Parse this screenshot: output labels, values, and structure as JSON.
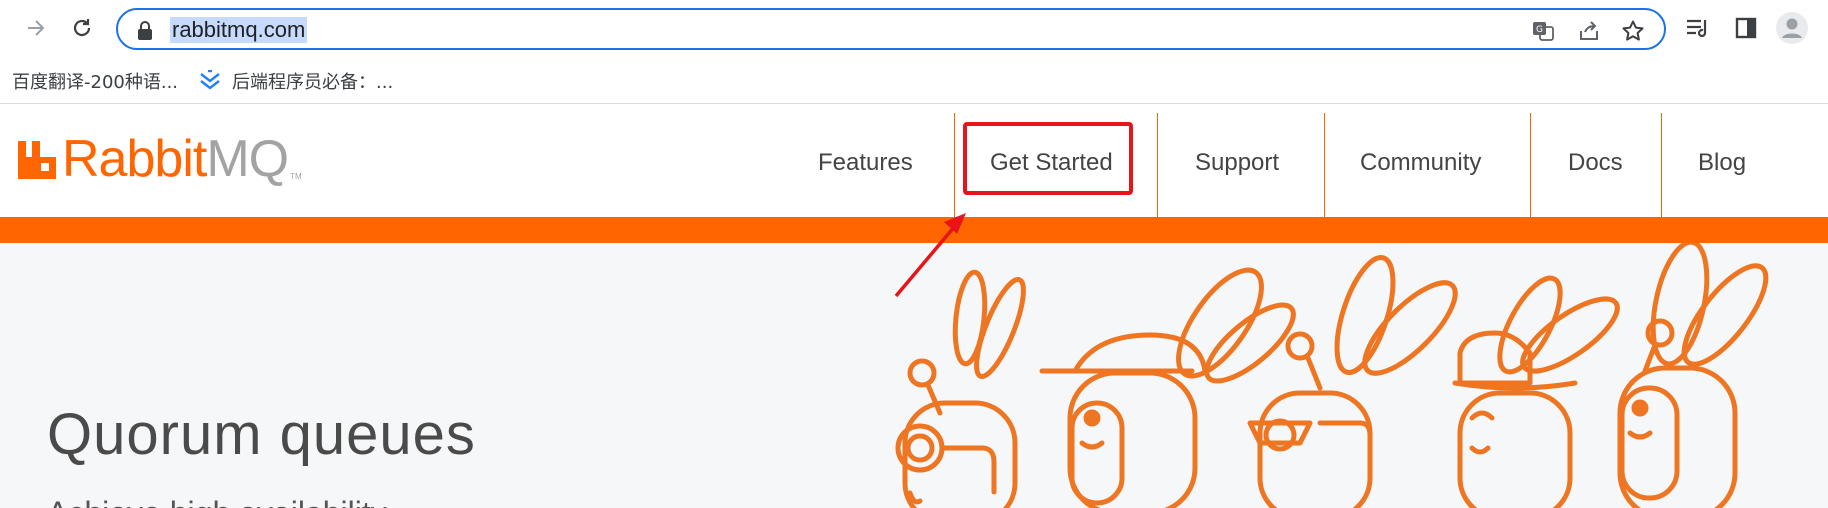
{
  "browser": {
    "url": "rabbitmq.com",
    "bookmarks": [
      {
        "label": "百度翻译-200种语..."
      },
      {
        "label": "后端程序员必备：..."
      }
    ]
  },
  "site": {
    "logo": {
      "primary": "Rabbit",
      "secondary": "MQ",
      "tm": "TM"
    },
    "nav": [
      {
        "label": "Features"
      },
      {
        "label": "Get Started"
      },
      {
        "label": "Support"
      },
      {
        "label": "Community"
      },
      {
        "label": "Docs"
      },
      {
        "label": "Blog"
      }
    ]
  },
  "hero": {
    "title": "Quorum queues",
    "subtitle": "Achieve high availability"
  },
  "colors": {
    "brand_orange": "#ff6600",
    "focus_blue": "#1a73e8",
    "annotation_red": "#e8141a"
  },
  "icons": [
    "forward-icon",
    "reload-icon",
    "lock-icon",
    "translate-icon",
    "share-icon",
    "star-icon",
    "reading-list-icon",
    "side-panel-icon",
    "profile-icon",
    "bookmark-icon"
  ]
}
